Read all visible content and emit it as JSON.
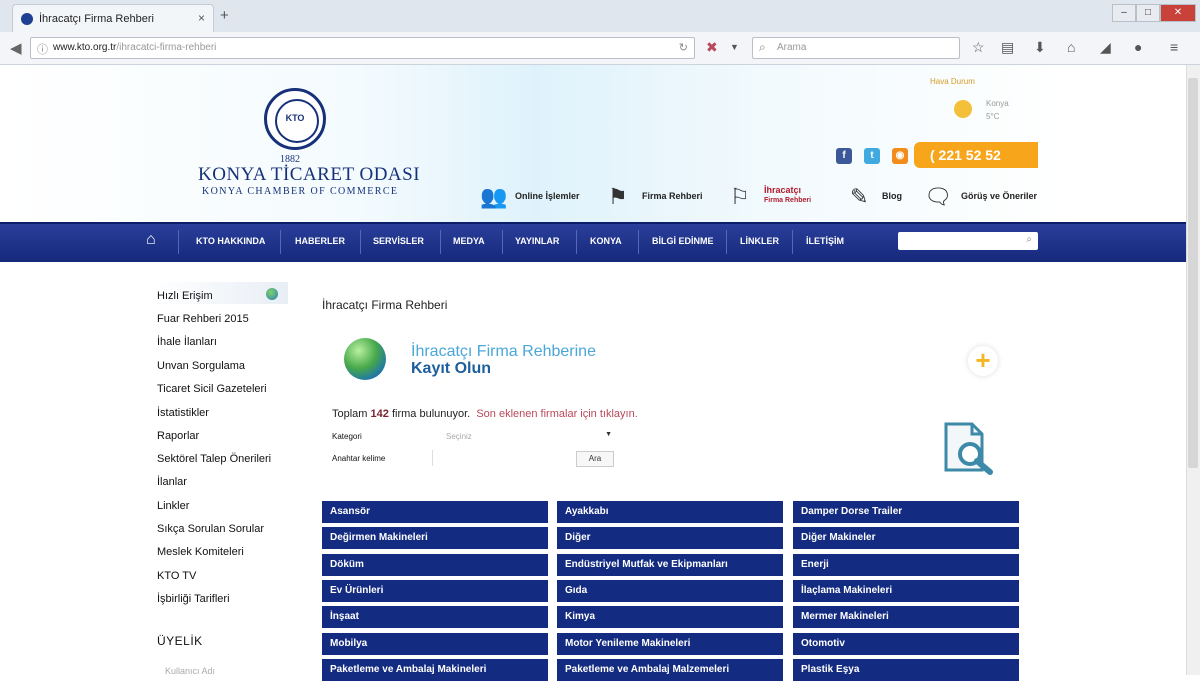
{
  "browser": {
    "tab_title": "İhracatçı Firma Rehberi",
    "tab_close": "×",
    "new_tab": "+",
    "url_domain": "www.kto.org.tr",
    "url_path": "/ihracatci-firma-rehberi",
    "search_placeholder": "Arama",
    "window_min": "–",
    "window_max": "□",
    "window_close": "✕"
  },
  "header": {
    "logo_monogram": "KTO",
    "logo_year": "1882",
    "logo_name": "KONYA TİCARET ODASI",
    "logo_subtitle": "KONYA CHAMBER OF COMMERCE",
    "weather_top": "Hava   Durum",
    "weather_city_line1": "Konya",
    "weather_city_line2": "5°C",
    "phone": "( 221 52 52",
    "quick_links": [
      {
        "label": "Online İşlemler",
        "icon": "users-icon"
      },
      {
        "label": "Firma Rehberi",
        "icon": "signpost-icon"
      },
      {
        "label_line1": "İhracatçı",
        "label_line2": "Firma Rehberi",
        "icon": "flag-icon"
      },
      {
        "label": "Blog",
        "icon": "edit-icon"
      },
      {
        "label": "Görüş ve Öneriler",
        "icon": "chat-icon"
      }
    ]
  },
  "nav": {
    "items": [
      "KTO HAKKINDA",
      "HABERLER",
      "SERVİSLER",
      "MEDYA",
      "YAYINLAR",
      "KONYA",
      "BİLGİ EDİNME",
      "LİNKLER",
      "İLETİŞİM"
    ]
  },
  "sidebar": {
    "items": [
      "Hızlı Erişim",
      "Fuar Rehberi 2015",
      "İhale İlanları",
      "Unvan Sorgulama",
      "Ticaret Sicil Gazeteleri",
      "İstatistikler",
      "Raporlar",
      "Sektörel Talep Önerileri",
      "İlanlar",
      "Linkler",
      "Sıkça Sorulan Sorular",
      "Meslek Komiteleri",
      "KTO TV",
      "İşbirliği Tarifleri"
    ],
    "membership_title": "ÜYELİK",
    "membership_sub": "Kullanıcı Adı"
  },
  "content": {
    "title": "İhracatçı Firma Rehberi",
    "banner_line1": "İhracatçı Firma Rehberine",
    "banner_line2": "Kayıt Olun",
    "total_prefix": "Toplam",
    "total_count": "142",
    "total_suffix": "firma bulunuyor.",
    "recent_link": "Son eklenen firmalar için tıklayın.",
    "category_label": "Kategori",
    "category_value": "Seçiniz",
    "keyword_label": "Anahtar kelime",
    "search_button": "Ara",
    "categories": [
      "Asansör",
      "Ayakkabı",
      "Damper Dorse Trailer",
      "Değirmen Makineleri",
      "Diğer",
      "Diğer Makineler",
      "Döküm",
      "Endüstriyel Mutfak ve Ekipmanları",
      "Enerji",
      "Ev Ürünleri",
      "Gıda",
      "İlaçlama Makineleri",
      "İnşaat",
      "Kimya",
      "Mermer Makineleri",
      "Mobilya",
      "Motor Yenileme Makineleri",
      "Otomotiv",
      "Paketleme ve Ambalaj Makineleri",
      "Paketleme ve Ambalaj Malzemeleri",
      "Plastik Eşya"
    ]
  }
}
